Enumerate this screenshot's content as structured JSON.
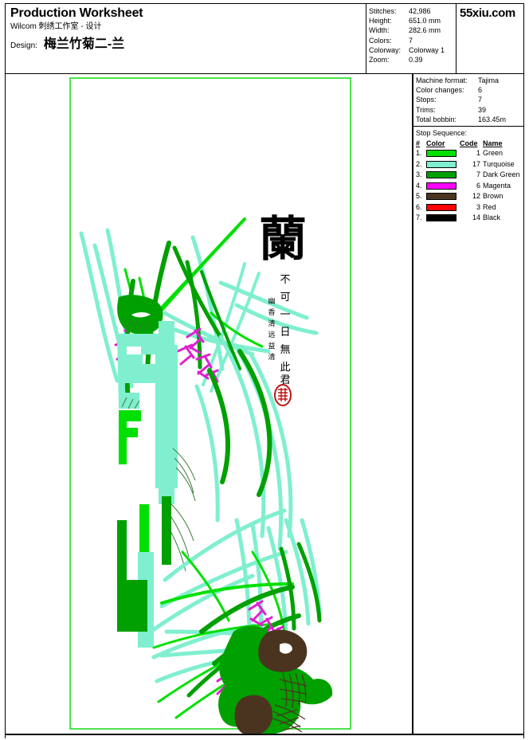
{
  "header": {
    "title": "Production Worksheet",
    "subtitle": "Wilcom 刺绣工作室 - 设计",
    "design_label": "Design:",
    "design_name": "梅兰竹菊二-兰",
    "brand": "55xiu.com",
    "stats": [
      {
        "key": "Stitches:",
        "value": "42,986"
      },
      {
        "key": "Height:",
        "value": "651.0 mm"
      },
      {
        "key": "Width:",
        "value": "282.6 mm"
      },
      {
        "key": "Colors:",
        "value": "7"
      },
      {
        "key": "Colorway:",
        "value": "Colorway 1"
      },
      {
        "key": "Zoom:",
        "value": "0.39"
      }
    ]
  },
  "machine_info": [
    {
      "key": "Machine format:",
      "value": "Tajima"
    },
    {
      "key": "Color changes:",
      "value": "6"
    },
    {
      "key": "Stops:",
      "value": "7"
    },
    {
      "key": "Trims:",
      "value": "39"
    },
    {
      "key": "Total bobbin:",
      "value": "163.45m"
    }
  ],
  "stop_sequence": {
    "title": "Stop Sequence:",
    "columns": [
      "#",
      "Color",
      "Code",
      "Name"
    ],
    "rows": [
      {
        "num": "1.",
        "code": "1",
        "name": "Green",
        "hex": "#00E000"
      },
      {
        "num": "2.",
        "code": "17",
        "name": "Turquoise",
        "hex": "#7FEFCF"
      },
      {
        "num": "3.",
        "code": "7",
        "name": "Dark Green",
        "hex": "#00A000"
      },
      {
        "num": "4.",
        "code": "6",
        "name": "Magenta",
        "hex": "#FF00FF"
      },
      {
        "num": "5.",
        "code": "12",
        "name": "Brown",
        "hex": "#4A3420"
      },
      {
        "num": "6.",
        "code": "3",
        "name": "Red",
        "hex": "#FF0000"
      },
      {
        "num": "7.",
        "code": "14",
        "name": "Black",
        "hex": "#000000"
      }
    ]
  },
  "design_canvas": {
    "hoop_border_color": "#4CE44C",
    "calligraphy_main_char": "蘭",
    "calligraphy_column": "不可一日無此君",
    "seal_color": "#C21515",
    "palette": {
      "green": "#00E000",
      "turquoise": "#7FEFCF",
      "dark_green": "#00A000",
      "magenta": "#E020D0",
      "brown": "#4A3420",
      "red": "#C21515",
      "black": "#000000"
    }
  }
}
